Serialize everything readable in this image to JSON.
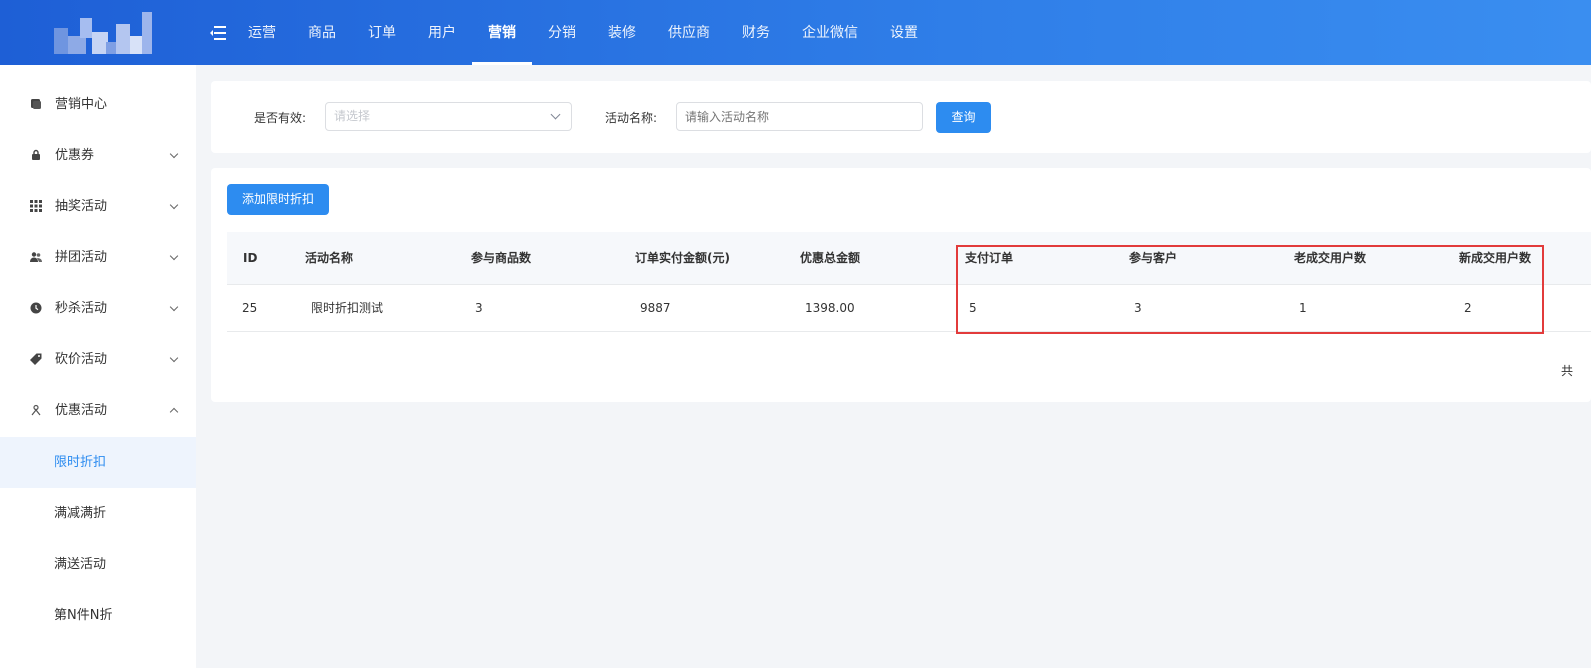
{
  "nav": {
    "items": [
      "运营",
      "商品",
      "订单",
      "用户",
      "营销",
      "分销",
      "装修",
      "供应商",
      "财务",
      "企业微信",
      "设置"
    ],
    "active": "营销"
  },
  "sidebar": {
    "items": [
      {
        "label": "营销中心",
        "icon": "stack-icon"
      },
      {
        "label": "优惠券",
        "icon": "lock-icon",
        "expand": "down"
      },
      {
        "label": "抽奖活动",
        "icon": "grid-icon",
        "expand": "down"
      },
      {
        "label": "拼团活动",
        "icon": "group-icon",
        "expand": "down"
      },
      {
        "label": "秒杀活动",
        "icon": "clock-icon",
        "expand": "down"
      },
      {
        "label": "砍价活动",
        "icon": "tag-icon",
        "expand": "down"
      },
      {
        "label": "优惠活动",
        "icon": "gift-icon",
        "expand": "up"
      }
    ],
    "subitems": [
      "限时折扣",
      "满减满折",
      "满送活动",
      "第N件N折"
    ],
    "active_sub": "限时折扣"
  },
  "filter": {
    "valid_label": "是否有效:",
    "valid_placeholder": "请选择",
    "name_label": "活动名称:",
    "name_placeholder": "请输入活动名称",
    "search_button": "查询"
  },
  "table": {
    "add_button": "添加限时折扣",
    "columns": [
      "ID",
      "活动名称",
      "参与商品数",
      "订单实付金额(元)",
      "优惠总金额",
      "支付订单",
      "参与客户",
      "老成交用户数",
      "新成交用户数"
    ],
    "rows": [
      [
        "25",
        "限时折扣测试",
        "3",
        "9887",
        "1398.00",
        "5",
        "3",
        "1",
        "2"
      ]
    ],
    "footer_fragment": "共"
  },
  "colors": {
    "header_gradient_start": "#1e5fd6",
    "header_gradient_end": "#3a8ef0",
    "primary": "#2d8cf0",
    "highlight_border": "#e23b3b"
  }
}
